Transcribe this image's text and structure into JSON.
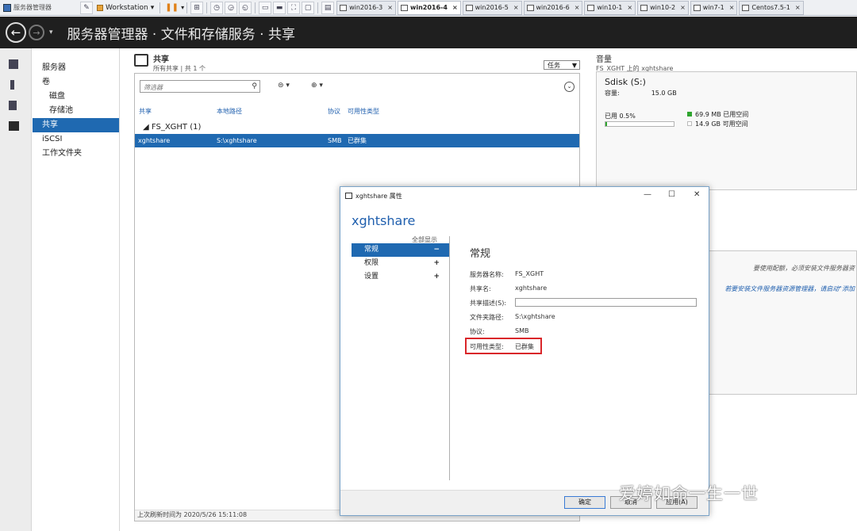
{
  "vmware": {
    "app_title": "服务器管理器",
    "workstation_label": "Workstation",
    "tabs": [
      "win2016-3",
      "win2016-4",
      "win2016-5",
      "win2016-6",
      "win10-1",
      "win10-2",
      "win7-1",
      "Centos7.5-1"
    ],
    "active_tab": "win2016-4"
  },
  "header": {
    "breadcrumb": "服务器管理器 · 文件和存储服务 · 共享"
  },
  "nav": {
    "items": [
      "服务器",
      "卷",
      "磁盘",
      "存储池",
      "共享",
      "iSCSI",
      "工作文件夹"
    ]
  },
  "shares": {
    "title": "共享",
    "subtitle": "所有共享 | 共 1 个",
    "tasks_label": "任务",
    "filter_placeholder": "筛选器",
    "columns": [
      "共享",
      "本地路径",
      "协议",
      "可用性类型"
    ],
    "group": "FS_XGHT (1)",
    "row": {
      "share": "xghtshare",
      "path": "S:\\xghtshare",
      "protocol": "SMB",
      "availability": "已群集"
    },
    "refresh": "上次刷新时间为 2020/5/26 15:11:08"
  },
  "volume": {
    "title": "音量",
    "subtitle": "FS_XGHT 上的 xghtshare",
    "name": "Sdisk (S:)",
    "capacity_label": "容量:",
    "capacity_value": "15.0 GB",
    "used_label": "已用 0.5%",
    "used_fraction": 0.005,
    "used_space": "69.9 MB 已用空间",
    "free_space": "14.9 GB 可用空间",
    "hint1": "要使用配额，必须安装文件服务器资",
    "hint2": "若要安装文件服务器资源管理器，请启动\"添加"
  },
  "dialog": {
    "title": "xghtshare 属性",
    "heading": "xghtshare",
    "show_all": "全部显示",
    "nav": [
      {
        "label": "常规",
        "sign": "−"
      },
      {
        "label": "权限",
        "sign": "+"
      },
      {
        "label": "设置",
        "sign": "+"
      }
    ],
    "section": "常规",
    "props": [
      {
        "label": "服务器名称:",
        "value": "FS_XGHT"
      },
      {
        "label": "共享名:",
        "value": "xghtshare"
      },
      {
        "label": "共享描述(S):",
        "value": ""
      },
      {
        "label": "文件夹路径:",
        "value": "S:\\xghtshare"
      },
      {
        "label": "协议:",
        "value": "SMB"
      },
      {
        "label": "可用性类型:",
        "value": "已群集"
      }
    ],
    "ok": "确定",
    "cancel": "取消",
    "apply": "应用(A)"
  },
  "watermark": "爱婷如命一生一世",
  "colors": {
    "accent": "#1f69b1",
    "highlight": "#d9262a",
    "header_bg": "#1f1f1f"
  }
}
